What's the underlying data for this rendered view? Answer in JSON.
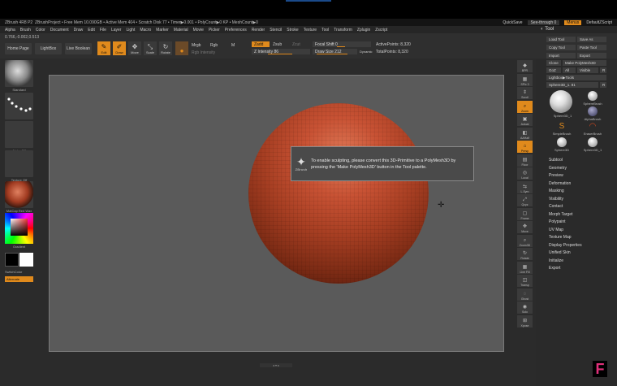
{
  "titlebar": {
    "app_title": "ZBrush 4R8 P2",
    "project": "ZBrushProject",
    "free_mem": "• Free Mem 10.090GB",
    "active_mem": "• Active Mem 404",
    "scratch": "• Scratch Disk 77",
    "timer": "• Timer▶0.001",
    "polycount": "• PolyCount▶0 KP",
    "meshcount": "• MeshCount▶0",
    "quicksave": "QuickSave",
    "see_through": "See-through  0",
    "menus_label": "Menus",
    "default_script": "DefaultZScript"
  },
  "menubar": [
    "Alpha",
    "Brush",
    "Color",
    "Document",
    "Draw",
    "Edit",
    "File",
    "Layer",
    "Light",
    "Macro",
    "Marker",
    "Material",
    "Movie",
    "Picker",
    "Preferences",
    "Render",
    "Stencil",
    "Stroke",
    "Texture",
    "Tool",
    "Transform",
    "Zplugin",
    "Zscript"
  ],
  "toolbar": {
    "coords": "0.766,-0.002,0.513",
    "home_page": "Home Page",
    "lightbox": "LightBox",
    "live_boolean": "Live Boolean",
    "edit": "Edit",
    "draw": "Draw",
    "move": "Move",
    "scale": "Scale",
    "rotate": "Rotate",
    "mrgb": "Mrgb",
    "rgb": "Rgb",
    "m": "M",
    "zadd": "Zadd",
    "zsub": "Zsub",
    "zcut": "Zcut",
    "rgb_intensity": "Rgb Intensity",
    "z_intensity": "Z Intensity 86",
    "focal_shift": "Focal Shift 0",
    "draw_size": "Draw Size 212",
    "dynamic": "Dynamic",
    "active_points": "ActivePoints: 8,320",
    "total_points": "TotalPoints: 8,320"
  },
  "left_shelf": {
    "brush": "Standard",
    "stroke": "Dots",
    "alpha": "Alpha Off",
    "texture": "Texture Off",
    "material": "MatCap Red Wax",
    "gradient": "Gradient",
    "switch_color": "SwitchColor",
    "alternate": "Alternate"
  },
  "canvas": {
    "tooltip_logo": "ZBrush",
    "tooltip_text": "To enable sculpting, please convert this 3D-Primitive to a PolyMesh3D by pressing the 'Make PolyMesh3D' button in the Tool palette.",
    "bottom_mark": "◂ ▾ ▸"
  },
  "right_shelf": [
    {
      "name": "bpr",
      "label": "BPR"
    },
    {
      "name": "spix",
      "label": "SPix 3"
    },
    {
      "name": "scroll",
      "label": "Scroll"
    },
    {
      "name": "zoom",
      "label": "Zoom"
    },
    {
      "name": "actual",
      "label": "Actual"
    },
    {
      "name": "aahalf",
      "label": "AAHalf"
    },
    {
      "name": "persp",
      "label": "Persp"
    },
    {
      "name": "floor",
      "label": "Floor"
    },
    {
      "name": "local",
      "label": "Local"
    },
    {
      "name": "lsym",
      "label": "L.Sym"
    },
    {
      "name": "qxyz",
      "label": "Qxyz"
    },
    {
      "name": "frame",
      "label": "Frame"
    },
    {
      "name": "move",
      "label": "Move"
    },
    {
      "name": "zoom3d",
      "label": "Zoom3D"
    },
    {
      "name": "rotate",
      "label": "Rotate"
    },
    {
      "name": "line-fill",
      "label": "Line Fill"
    },
    {
      "name": "transp",
      "label": "Transp"
    },
    {
      "name": "ghost",
      "label": "Ghost"
    },
    {
      "name": "solo",
      "label": "Solo"
    },
    {
      "name": "xpose",
      "label": "Xpose"
    }
  ],
  "tool_palette": {
    "title": "Tool",
    "load_tool": "Load Tool",
    "save_as": "Save As",
    "copy_tool": "Copy Tool",
    "paste_tool": "Paste Tool",
    "import": "Import",
    "export": "Export",
    "clone": "Clone",
    "make_polymesh": "Make PolyMesh3D",
    "goz": "GoZ",
    "all": "All",
    "visible": "Visible",
    "r": "R",
    "lightbox_tools": "Lightbox▶Tools",
    "current_tool": "Sphere3D_1. 81",
    "r2": "R",
    "tools": [
      {
        "label": "Sphere3D_1"
      },
      {
        "label": "SphereBrush"
      },
      {
        "label": "AlphaBrush"
      },
      {
        "label": "SimpleBrush"
      },
      {
        "label": "EraserBrush"
      },
      {
        "label": "Sphere3D"
      },
      {
        "label": "Sphere3D_1"
      }
    ],
    "subpalettes": [
      "Subtool",
      "Geometry",
      "Preview",
      "Deformation",
      "Masking",
      "Visibility",
      "Contact",
      "Morph Target",
      "Polypaint",
      "UV Map",
      "Texture Map",
      "Display Properties",
      "Unified Skin",
      "Initialize",
      "Export"
    ]
  },
  "colors": {
    "accent": "#e08a1c",
    "doc_bg": "#5a5a5a",
    "panel_bg": "#2b2b2b",
    "sphere": "#b8482a"
  },
  "corner_mark": "F"
}
